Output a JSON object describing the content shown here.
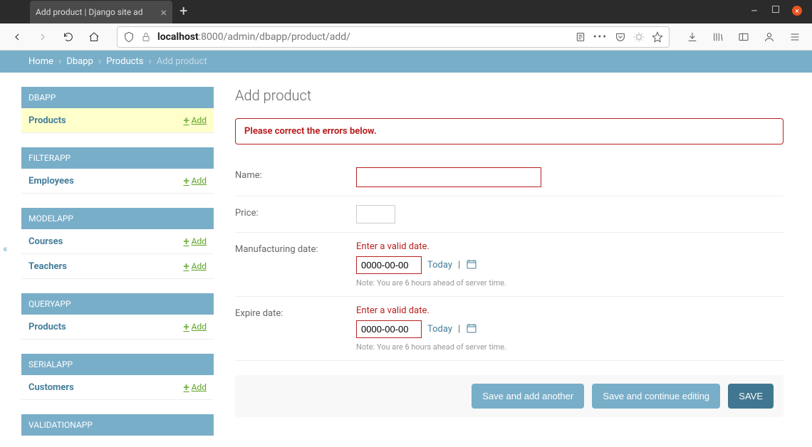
{
  "browser": {
    "tab_title": "Add product | Django site ad",
    "url_host": "localhost",
    "url_port_path": ":8000/admin/dbapp/product/add/"
  },
  "breadcrumb": {
    "home": "Home",
    "app": "Dbapp",
    "model": "Products",
    "current": "Add product"
  },
  "sidebar": {
    "modules": [
      {
        "caption": "DBAPP",
        "rows": [
          {
            "label": "Products",
            "add": "Add",
            "highlight": true
          }
        ]
      },
      {
        "caption": "FILTERAPP",
        "rows": [
          {
            "label": "Employees",
            "add": "Add"
          }
        ]
      },
      {
        "caption": "MODELAPP",
        "rows": [
          {
            "label": "Courses",
            "add": "Add"
          },
          {
            "label": "Teachers",
            "add": "Add"
          }
        ]
      },
      {
        "caption": "QUERYAPP",
        "rows": [
          {
            "label": "Products",
            "add": "Add"
          }
        ]
      },
      {
        "caption": "SERIALAPP",
        "rows": [
          {
            "label": "Customers",
            "add": "Add"
          }
        ]
      },
      {
        "caption": "VALIDATIONAPP",
        "rows": []
      }
    ]
  },
  "page_title": "Add product",
  "errornote": "Please correct the errors below.",
  "form": {
    "name": {
      "label": "Name:",
      "value": ""
    },
    "price": {
      "label": "Price:",
      "value": ""
    },
    "mfg": {
      "label": "Manufacturing date:",
      "error": "Enter a valid date.",
      "value": "0000-00-00",
      "today": "Today",
      "help": "Note: You are 6 hours ahead of server time."
    },
    "exp": {
      "label": "Expire date:",
      "error": "Enter a valid date.",
      "value": "0000-00-00",
      "today": "Today",
      "help": "Note: You are 6 hours ahead of server time."
    }
  },
  "buttons": {
    "save_add": "Save and add another",
    "save_cont": "Save and continue editing",
    "save": "SAVE"
  }
}
